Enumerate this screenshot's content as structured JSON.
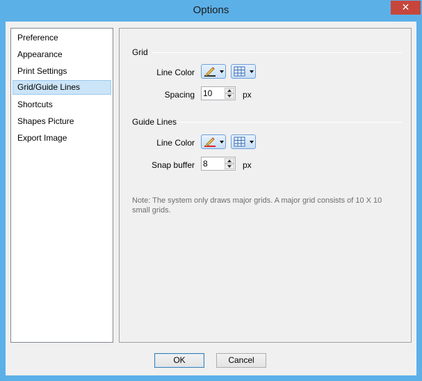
{
  "window": {
    "title": "Options",
    "close_label": "✕"
  },
  "nav": {
    "items": [
      {
        "label": "Preference"
      },
      {
        "label": "Appearance"
      },
      {
        "label": "Print Settings"
      },
      {
        "label": "Grid/Guide Lines",
        "selected": true
      },
      {
        "label": "Shortcuts"
      },
      {
        "label": "Shapes Picture"
      },
      {
        "label": "Export Image"
      }
    ]
  },
  "grid": {
    "title": "Grid",
    "line_color_label": "Line Color",
    "spacing_label": "Spacing",
    "spacing_value": "10",
    "spacing_unit": "px"
  },
  "guide_lines": {
    "title": "Guide Lines",
    "line_color_label": "Line Color",
    "snap_label": "Snap buffer",
    "snap_value": "8",
    "snap_unit": "px"
  },
  "note": "Note: The system only draws major grids. A major grid consists of 10 X 10 small grids.",
  "buttons": {
    "ok": "OK",
    "cancel": "Cancel"
  },
  "colors": {
    "accent": "#5cb0e8",
    "selection": "#cce4f7",
    "close": "#c7463c"
  }
}
